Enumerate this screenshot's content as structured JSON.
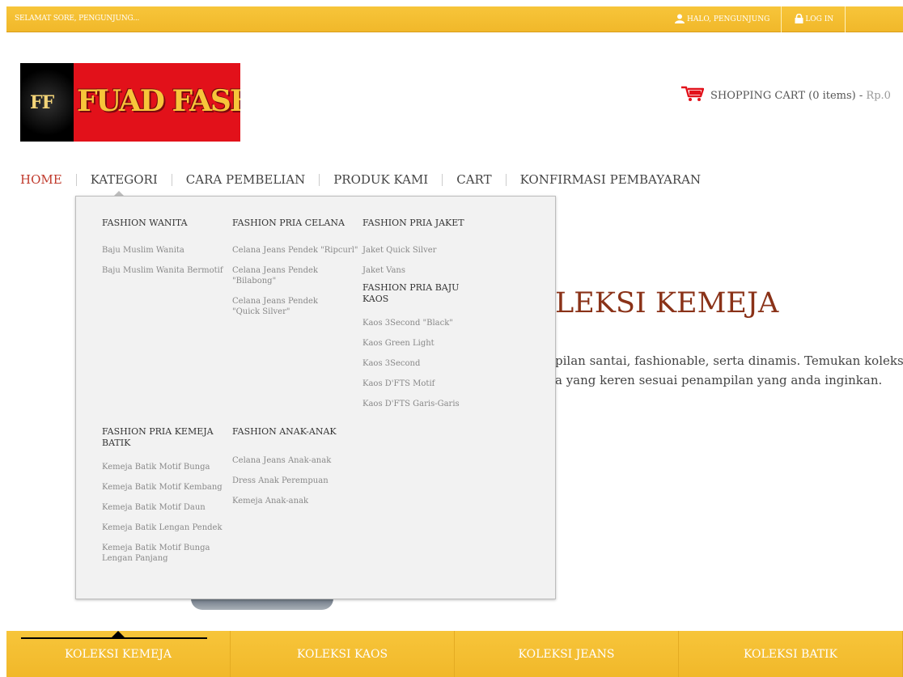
{
  "topbar": {
    "greeting": "SELAMAT SORE, PENGUNJUNG...",
    "user_label": "HALO, PENGUNJUNG",
    "login_label": "LOG IN",
    "user_icon": "user-icon",
    "lock_icon": "lock-icon"
  },
  "logo": {
    "initials": "FF",
    "name": "FUAD FASHION"
  },
  "cart": {
    "icon": "shopping-cart-icon",
    "label": "SHOPPING CART (0 items) - ",
    "price": "Rp.0"
  },
  "nav": {
    "items": [
      "HOME",
      "KATEGORI",
      "CARA PEMBELIAN",
      "PRODUK KAMI",
      "CART",
      "KONFIRMASI PEMBAYARAN"
    ]
  },
  "dropdown": {
    "categories": [
      {
        "title": "FASHION WANITA",
        "items": [
          "Baju Muslim Wanita",
          "Baju Muslim Wanita Bermotif"
        ]
      },
      {
        "title": "FASHION PRIA CELANA",
        "items": [
          "Celana Jeans Pendek \"Ripcurl\"",
          "Celana Jeans Pendek \"Bilabong\"",
          "Celana Jeans Pendek \"Quick Silver\""
        ]
      },
      {
        "title": "FASHION PRIA JAKET",
        "items": [
          "Jaket Quick Silver",
          "Jaket Vans"
        ]
      },
      {
        "title": "FASHION PRIA BAJU KAOS",
        "items": [
          "Kaos 3Second \"Black\"",
          "Kaos Green Light",
          "Kaos 3Second",
          "Kaos D'FTS Motif",
          "Kaos D'FTS Garis-Garis"
        ]
      },
      {
        "title": "FASHION PRIA KEMEJA BATIK",
        "items": [
          "Kemeja Batik Motif Bunga",
          "Kemeja Batik Motif Kembang",
          "Kemeja Batik Motif Daun",
          "Kemeja Batik Lengan Pendek",
          "Kemeja Batik Motif Bunga Lengan Panjang"
        ]
      },
      {
        "title": "FASHION ANAK-ANAK",
        "items": [
          "Celana Jeans Anak-anak",
          "Dress Anak Perempuan",
          "Kemeja Anak-anak"
        ]
      }
    ]
  },
  "main": {
    "headline": "LEKSI KEMEJA",
    "para_line1": "pilan santai, fashionable, serta dinamis. Temukan koleksi",
    "para_line2": "a yang keren sesuai penampilan yang anda inginkan."
  },
  "bottom": {
    "tabs": [
      "KOLEKSI KEMEJA",
      "KOLEKSI KAOS",
      "KOLEKSI JEANS",
      "KOLEKSI BATIK"
    ]
  },
  "colors": {
    "accent": "#f3bd30",
    "brand_red": "#e2111a",
    "active_nav": "#c0392b",
    "headline": "#8a3218"
  }
}
